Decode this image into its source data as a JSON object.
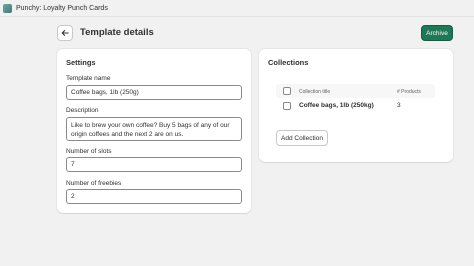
{
  "app": {
    "title": "Punchy: Loyalty Punch Cards",
    "icon": "app-logo-icon"
  },
  "header": {
    "back_icon": "arrow-left-icon",
    "title": "Template details",
    "archive_label": "Archive"
  },
  "settings": {
    "heading": "Settings",
    "template_name": {
      "label": "Template name",
      "value": "Coffee bags, 1lb (250g)"
    },
    "description": {
      "label": "Description",
      "value": "Like to brew your own coffee? Buy 5 bags of any of our origin coffees and the next 2 are on us."
    },
    "number_of_slots": {
      "label": "Number of slots",
      "value": "7"
    },
    "number_of_freebies": {
      "label": "Number of freebies",
      "value": "2"
    }
  },
  "collections": {
    "heading": "Collections",
    "columns": [
      "Collection title",
      "# Products"
    ],
    "rows": [
      {
        "title": "Coffee bags, 1lb (250kg)",
        "products": "3"
      }
    ],
    "add_label": "Add Collection"
  },
  "colors": {
    "primary": "#1e7756",
    "background": "#f1f1f1"
  }
}
